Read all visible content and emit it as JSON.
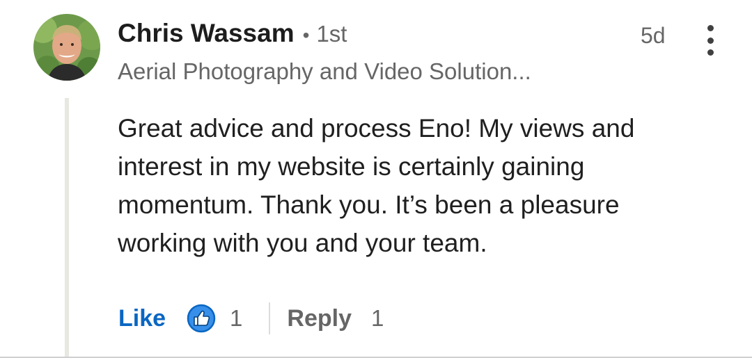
{
  "comment": {
    "author_name": "Chris Wassam",
    "separator": "•",
    "connection_degree": "1st",
    "headline": "Aerial Photography and Video Solution...",
    "timestamp": "5d",
    "body_lines": [
      "Great advice and process Eno! My views and",
      "interest in my website is certainly gaining",
      "momentum. Thank you. It’s been a pleasure",
      "working with you and your team."
    ]
  },
  "actions": {
    "like_label": "Like",
    "like_count": "1",
    "reply_label": "Reply",
    "reply_count": "1"
  },
  "icons": {
    "avatar": "profile-photo",
    "more": "vertical-ellipsis-icon",
    "reaction": "thumbs-up-icon"
  },
  "colors": {
    "like_blue": "#0a66c2",
    "reaction_blue": "#378fe9",
    "secondary_text": "#666666",
    "primary_text": "#1d1d1d"
  }
}
